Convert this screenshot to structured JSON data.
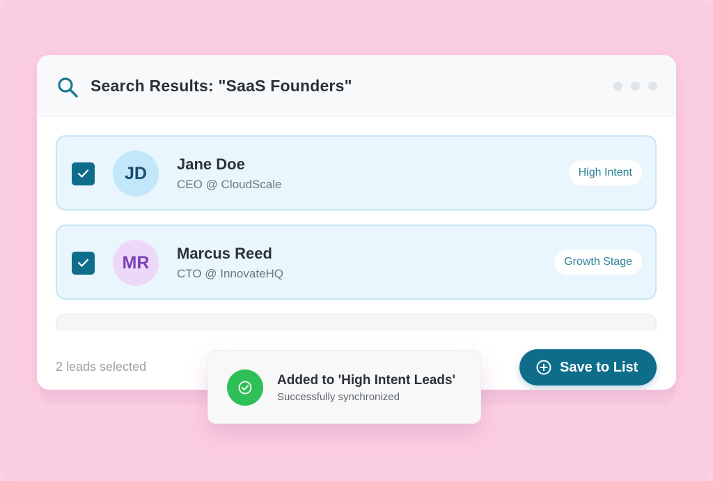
{
  "header": {
    "title": "Search Results: \"SaaS Founders\""
  },
  "leads": [
    {
      "initials": "JD",
      "name": "Jane Doe",
      "role": "CEO @ CloudScale",
      "tag": "High Intent",
      "checked": true
    },
    {
      "initials": "MR",
      "name": "Marcus Reed",
      "role": "CTO @ InnovateHQ",
      "tag": "Growth Stage",
      "checked": true
    }
  ],
  "footer": {
    "selected_count": "2 leads selected",
    "save_button": "Save to List"
  },
  "toast": {
    "title": "Added to 'High Intent Leads'",
    "subtitle": "Successfully synchronized"
  },
  "colors": {
    "background": "#fdd0e6",
    "accent": "#0f6d8c",
    "success": "#2fbf58"
  },
  "icons": {
    "search": "search-icon",
    "checkbox": "check-icon",
    "add": "plus-circle-icon",
    "success": "check-circle-icon"
  }
}
